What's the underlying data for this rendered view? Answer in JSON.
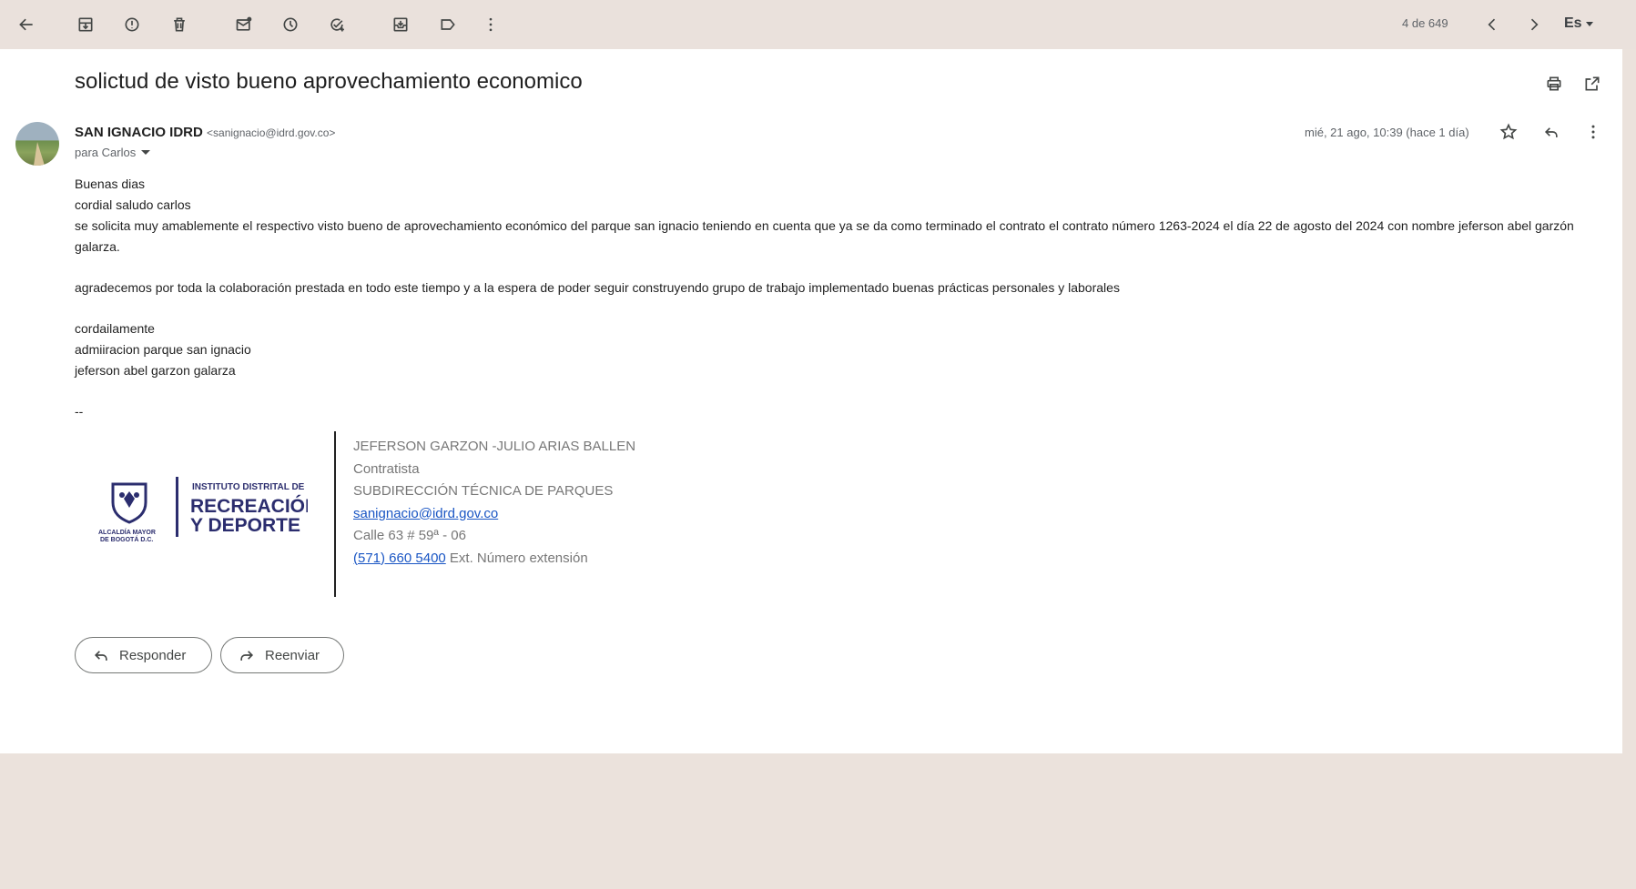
{
  "toolbar": {
    "icons": [
      "back-arrow-icon",
      "archive-icon",
      "report-spam-icon",
      "delete-icon",
      "mark-unread-icon",
      "snooze-icon",
      "add-task-icon",
      "move-to-icon",
      "label-icon",
      "more-vert-icon",
      "chevron-left-icon",
      "chevron-right-icon"
    ],
    "count": "4 de 649",
    "language": "Es"
  },
  "email": {
    "subject": "solictud de visto bueno aprovechamiento economico",
    "sender_name": "SAN IGNACIO IDRD",
    "sender_email": "<sanignacio@idrd.gov.co>",
    "recipient": "para Carlos",
    "date": "mié, 21 ago, 10:39 (hace 1 día)",
    "body": [
      "Buenas dias",
      "cordial saludo carlos",
      "se solicita muy amablemente el respectivo visto bueno de aprovechamiento económico del parque san ignacio teniendo en cuenta que ya se da como terminado el contrato  el contrato número 1263-2024 el día 22 de agosto del 2024 con  nombre jeferson abel garzón galarza.",
      "agradecemos por toda la colaboración prestada en todo este tiempo y a la espera de poder seguir construyendo grupo de trabajo implementado buenas prácticas personales y laborales",
      "cordailamente",
      "admiiracion parque san ignacio",
      "jeferson abel garzon galarza",
      "--"
    ]
  },
  "signature": {
    "logo": {
      "mayor_text": "ALCALDÍA MAYOR DE BOGOTÁ D.C.",
      "line1": "INSTITUTO DISTRITAL DE",
      "line2": "RECREACIÓN",
      "line3": "Y DEPORTE",
      "color": "#2b2d6e"
    },
    "name": "JEFERSON GARZON -JULIO ARIAS BALLEN",
    "role": "Contratista",
    "department": "SUBDIRECCIÓN TÉCNICA DE PARQUES",
    "email": "sanignacio@idrd.gov.co",
    "address": "Calle 63 # 59ª - 06",
    "phone": "(571) 660 5400",
    "extension": "Ext. Número extensión"
  },
  "actions": {
    "reply": "Responder",
    "forward": "Reenviar"
  },
  "colors": {
    "frame_bg": "#ebe2dc",
    "link": "#1a56c4"
  }
}
